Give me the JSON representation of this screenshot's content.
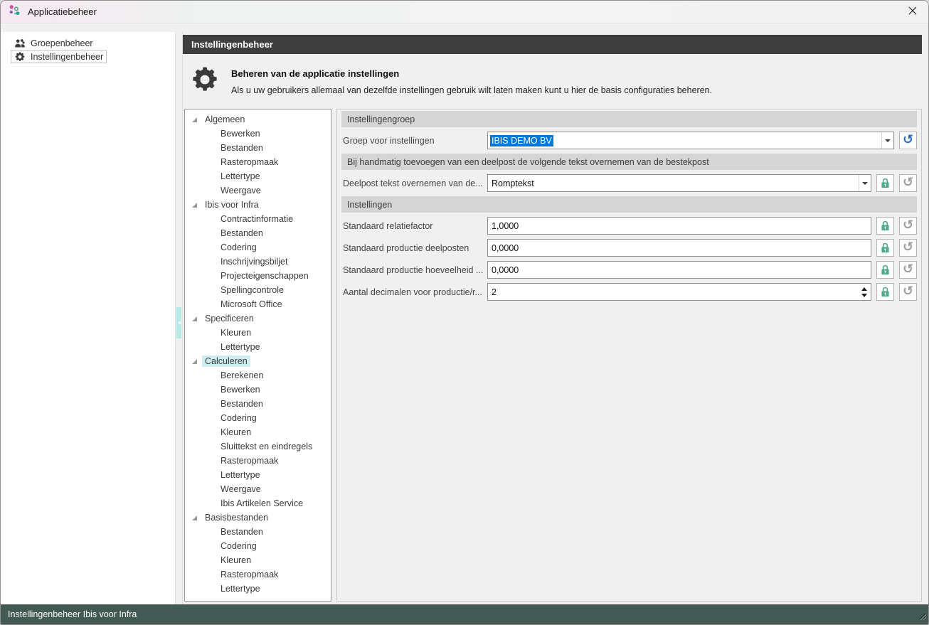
{
  "window": {
    "title": "Applicatiebeheer"
  },
  "sidebar": {
    "items": [
      {
        "id": "groepenbeheer",
        "label": "Groepenbeheer",
        "icon": "users-icon",
        "selected": false
      },
      {
        "id": "instellingenbeheer",
        "label": "Instellingenbeheer",
        "icon": "gear-icon",
        "selected": true
      }
    ]
  },
  "main": {
    "bar_title": "Instellingenbeheer",
    "intro_title": "Beheren van de applicatie instellingen",
    "intro_description": "Als u uw gebruikers allemaal van dezelfde instellingen gebruik wilt laten maken kunt u hier de basis configuraties beheren."
  },
  "tree": {
    "items": [
      {
        "label": "Algemeen",
        "level": 0,
        "expander": true
      },
      {
        "label": "Bewerken",
        "level": 1
      },
      {
        "label": "Bestanden",
        "level": 1
      },
      {
        "label": "Rasteropmaak",
        "level": 1
      },
      {
        "label": "Lettertype",
        "level": 1
      },
      {
        "label": "Weergave",
        "level": 1
      },
      {
        "label": "Ibis voor Infra",
        "level": 0,
        "expander": true
      },
      {
        "label": "Contractinformatie",
        "level": 1
      },
      {
        "label": "Bestanden",
        "level": 1
      },
      {
        "label": "Codering",
        "level": 1
      },
      {
        "label": "Inschrijvingsbiljet",
        "level": 1
      },
      {
        "label": "Projecteigenschappen",
        "level": 1
      },
      {
        "label": "Spellingcontrole",
        "level": 1
      },
      {
        "label": "Microsoft Office",
        "level": 1
      },
      {
        "label": "Specificeren",
        "level": 0,
        "expander": true
      },
      {
        "label": "Kleuren",
        "level": 1
      },
      {
        "label": "Lettertype",
        "level": 1
      },
      {
        "label": "Calculeren",
        "level": 0,
        "expander": true,
        "selected": true
      },
      {
        "label": "Berekenen",
        "level": 1
      },
      {
        "label": "Bewerken",
        "level": 1
      },
      {
        "label": "Bestanden",
        "level": 1
      },
      {
        "label": "Codering",
        "level": 1
      },
      {
        "label": "Kleuren",
        "level": 1
      },
      {
        "label": "Sluittekst en eindregels",
        "level": 1
      },
      {
        "label": "Rasteropmaak",
        "level": 1
      },
      {
        "label": "Lettertype",
        "level": 1
      },
      {
        "label": "Weergave",
        "level": 1
      },
      {
        "label": "Ibis Artikelen Service",
        "level": 1
      },
      {
        "label": "Basisbestanden",
        "level": 0,
        "expander": true
      },
      {
        "label": "Bestanden",
        "level": 1
      },
      {
        "label": "Codering",
        "level": 1
      },
      {
        "label": "Kleuren",
        "level": 1
      },
      {
        "label": "Rasteropmaak",
        "level": 1
      },
      {
        "label": "Lettertype",
        "level": 1
      }
    ]
  },
  "form": {
    "blocks": [
      {
        "type": "header",
        "text": "Instellingengroep"
      },
      {
        "type": "row",
        "label": "Groep voor instellingen",
        "control": "combo",
        "value": "IBIS DEMO BV",
        "value_selected": true,
        "buttons": [
          "undo-primary"
        ]
      },
      {
        "type": "header",
        "text": "Bij handmatig toevoegen van een deelpost de volgende tekst overnemen van de bestekpost"
      },
      {
        "type": "row",
        "label": "Deelpost tekst overnemen van de...",
        "control": "combo",
        "value": "Romptekst",
        "buttons": [
          "lock",
          "undo"
        ]
      },
      {
        "type": "header",
        "text": "Instellingen"
      },
      {
        "type": "row",
        "label": "Standaard relatiefactor",
        "control": "text",
        "value": "1,0000",
        "buttons": [
          "lock",
          "undo"
        ]
      },
      {
        "type": "row",
        "label": "Standaard productie deelposten",
        "control": "text",
        "value": "0,0000",
        "buttons": [
          "lock",
          "undo"
        ]
      },
      {
        "type": "row",
        "label": "Standaard  productie hoeveelheid ...",
        "control": "text",
        "value": "0,0000",
        "buttons": [
          "lock",
          "undo"
        ]
      },
      {
        "type": "row",
        "label": "Aantal decimalen voor productie/r...",
        "control": "spinner",
        "value": "2",
        "buttons": [
          "lock",
          "undo"
        ]
      }
    ]
  },
  "statusbar": {
    "text": "Instellingenbeheer Ibis voor Infra"
  },
  "colors": {
    "accent": "#0078d7",
    "lock-green": "#4fa98a",
    "undo-blue": "#2a6bc8",
    "undo-gray": "#9d9d9d",
    "tree-selection": "#cdecef",
    "splitter-handle": "#b7e9e7",
    "statusbar-bg": "#425954",
    "panel-header-bg": "#3e3e3e",
    "section-header-bg": "#d5d5d5"
  }
}
